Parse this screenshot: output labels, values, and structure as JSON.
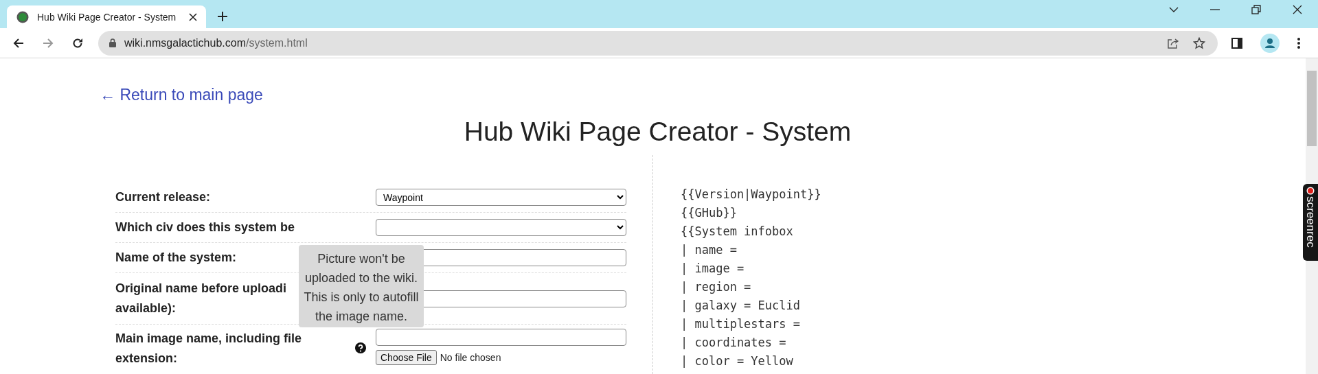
{
  "browser": {
    "tab": {
      "title": "Hub Wiki Page Creator - System",
      "selected": true
    },
    "address": {
      "host": "wiki.nmsgalactichub.com",
      "path": "/system.html"
    }
  },
  "page": {
    "back_link": "← Return to main page",
    "title": "Hub Wiki Page Creator - System",
    "form": [
      {
        "kind": "select",
        "label": "Current release:",
        "value": "Waypoint"
      },
      {
        "kind": "select",
        "label": "Which civ does this system be"
      },
      {
        "kind": "text",
        "label": "Name of the system:"
      },
      {
        "kind": "text",
        "label": "Original name before uploadi\navailable):"
      },
      {
        "kind": "image",
        "label": "Main image name, including file extension:",
        "file_button": "Choose File",
        "file_status": "No file chosen"
      }
    ],
    "tooltip": "Picture won't be uploaded to the wiki. This is only to autofill the image name.",
    "code_lines": [
      "{{Version|Waypoint}}",
      "{{GHub}}",
      "{{System infobox",
      "| name =",
      "| image =",
      "| region =",
      "| galaxy = Euclid",
      "| multiplestars =",
      "| coordinates =",
      "| color = Yellow"
    ]
  },
  "recorder_badge": "screenrec"
}
